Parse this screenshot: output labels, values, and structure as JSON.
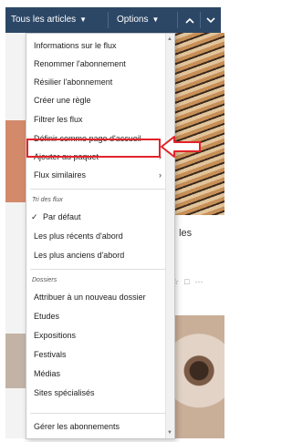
{
  "toolbar": {
    "articles_label": "Tous les articles",
    "options_label": "Options"
  },
  "background": {
    "partial_title": ": les"
  },
  "menu": {
    "items_top": [
      {
        "label": "Informations sur le flux",
        "submenu": false
      },
      {
        "label": "Renommer l'abonnement",
        "submenu": false
      },
      {
        "label": "Résilier l'abonnement",
        "submenu": false
      },
      {
        "label": "Créer une règle",
        "submenu": false
      },
      {
        "label": "Filtrer les flux",
        "submenu": false
      },
      {
        "label": "Définir comme page d'accueil",
        "submenu": false
      },
      {
        "label": "Ajouter au paquet",
        "submenu": true
      },
      {
        "label": "Flux similaires",
        "submenu": true
      }
    ],
    "sort_section": {
      "label": "Tri des flux",
      "options": [
        {
          "label": "Par défaut",
          "checked": true
        },
        {
          "label": "Les plus récents d'abord",
          "checked": false
        },
        {
          "label": "Les plus anciens d'abord",
          "checked": false
        }
      ]
    },
    "folders_section": {
      "label": "Dossiers",
      "items": [
        {
          "label": "Attribuer à un nouveau dossier"
        },
        {
          "label": "Etudes"
        },
        {
          "label": "Expositions"
        },
        {
          "label": "Festivals"
        },
        {
          "label": "Médias"
        },
        {
          "label": "Sites spécialisés"
        }
      ]
    },
    "footer_item": "Gérer les abonnements"
  },
  "colors": {
    "toolbar_bg": "#2c4766",
    "highlight": "#e2232a"
  }
}
